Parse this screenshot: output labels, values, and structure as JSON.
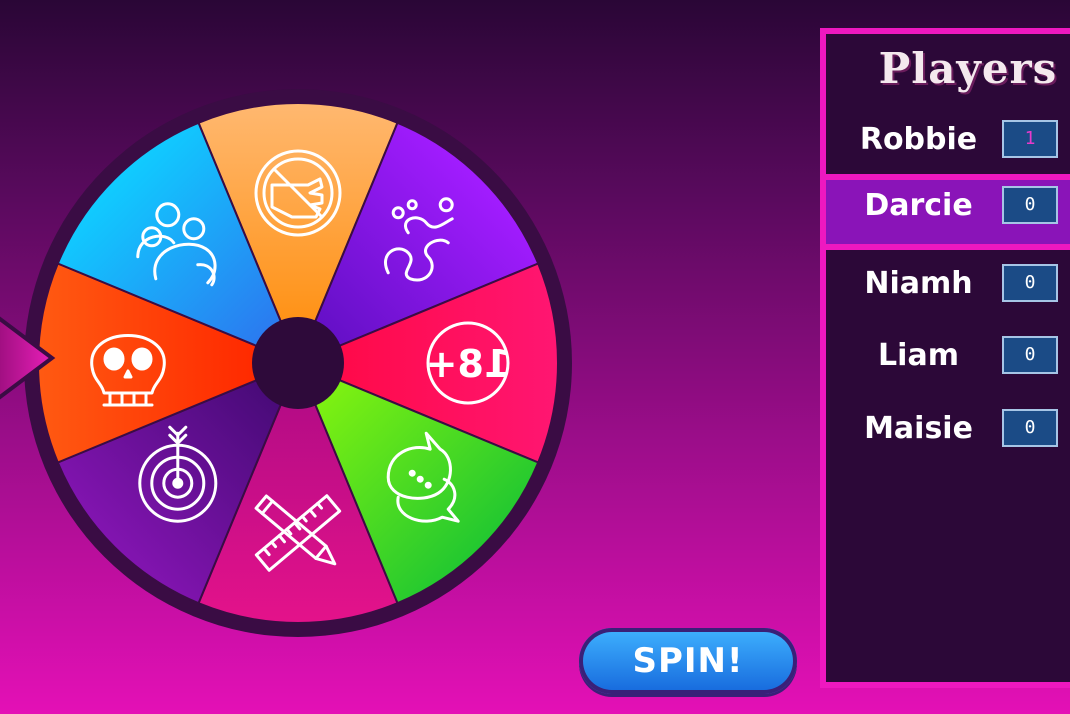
{
  "players_panel": {
    "title": "Players",
    "players": [
      {
        "name": "Robbie",
        "score": "1"
      },
      {
        "name": "Darcie",
        "score": "0"
      },
      {
        "name": "Niamh",
        "score": "0"
      },
      {
        "name": "Liam",
        "score": "0"
      },
      {
        "name": "Maisie",
        "score": "0"
      }
    ],
    "active_player_index": 1
  },
  "spin_button": {
    "label": "SPIN!"
  },
  "wheel": {
    "segments": [
      {
        "icon": "stop-hand-icon",
        "label": "",
        "color_start": "#ffb870",
        "color_end": "#ff9318"
      },
      {
        "icon": "smoke-icon",
        "label": "",
        "color_start": "#a21cff",
        "color_end": "#6610c8"
      },
      {
        "icon": "age-18-plus-icon",
        "label": "18+",
        "color_start": "#ff1672",
        "color_end": "#ff0a4a"
      },
      {
        "icon": "chat-bubbles-icon",
        "label": "",
        "color_start": "#22c830",
        "color_end": "#7cf012"
      },
      {
        "icon": "pencil-ruler-icon",
        "label": "",
        "color_start": "#e4128a",
        "color_end": "#b60c86"
      },
      {
        "icon": "target-icon",
        "label": "",
        "color_start": "#8214b0",
        "color_end": "#4a0b7a"
      },
      {
        "icon": "skull-icon",
        "label": "",
        "color_start": "#ff5a12",
        "color_end": "#ff2a00"
      },
      {
        "icon": "group-icon",
        "label": "",
        "color_start": "#10ccff",
        "color_end": "#2a7cf0"
      }
    ],
    "rim_color": "#3a0c44",
    "pointer_color": "#d81ca8"
  }
}
